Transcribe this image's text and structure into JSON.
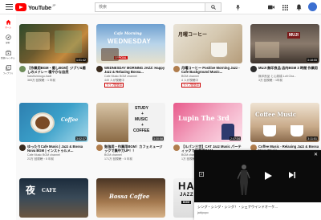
{
  "header": {
    "logo_text": "YouTube",
    "logo_region": "JP",
    "search_placeholder": "検索"
  },
  "sidebar": {
    "items": [
      {
        "label": "ホーム",
        "icon": "home-icon"
      },
      {
        "label": "探索",
        "icon": "explore-icon"
      },
      {
        "label": "登録チャンネル",
        "icon": "subscriptions-icon"
      },
      {
        "label": "ライブラリ",
        "icon": "library-icon"
      }
    ]
  },
  "videos": [
    {
      "title": "【作業用BGM・癒しBGM】ジブリ&癒しのメドレー 穏やかな自然",
      "channel": "harufiu/shogu-hadt",
      "stats": "369万 回視聴・1 年前",
      "duration": "1:01:42",
      "live": ""
    },
    {
      "title": "WEDNESDAY MORNING JAZZ: Happy Jazz & Relaxing Bossa...",
      "channel": "Cafe Music BGM channel",
      "stats": "449 人が視聴中",
      "duration": "",
      "live": "ライブ配信中"
    },
    {
      "title": "月曜コーヒー Positive Morning Jazz - Cafe Background Music...",
      "channel": "BGM channel",
      "stats": "4 人が視聴中",
      "duration": "",
      "live": "ライブ配信中"
    },
    {
      "title": "MUJI 無印良品 店内BGM 3 時間 作業用",
      "channel": "無印良品 と心斎橋 Lofi Cha...",
      "stats": "3万 回視聴・1年前",
      "duration": "3:18:55",
      "live": ""
    },
    {
      "title": "ゆったりCafe Music | Jazz & Bossa Nova BGM | インストゥルメ...",
      "channel": "Cafe Music BGM channel",
      "stats": "23万 回視聴・5 年前",
      "duration": "3:02:37",
      "live": ""
    },
    {
      "title": "勉強用・作業用BGM！カフェミュージックで集中力UP！！",
      "channel": "BGM channel",
      "stats": "171万 回視聴・5 年前",
      "duration": "3:30:58",
      "live": ""
    },
    {
      "title": "【ルパン三世】CAT Jazz Music パーティックで作業用BGM",
      "channel": "BGM channel",
      "stats": "1万 回視聴・5 年前",
      "duration": "2:07:34",
      "live": ""
    },
    {
      "title": "Coffee Music - Relaxing Jazz & Bossa Nova Music...",
      "channel": "BGM channel",
      "stats": "6万 回視聴・3 年前",
      "duration": "3:11:51",
      "live": ""
    },
    {
      "title": "夜 CAFE",
      "channel": "",
      "stats": "",
      "duration": "",
      "live": ""
    },
    {
      "title": "Bossa Coffee",
      "channel": "",
      "stats": "",
      "duration": "",
      "live": ""
    },
    {
      "title": "HAPPY JAZZ BOSSA",
      "channel": "",
      "stats": "",
      "duration": "",
      "live": ""
    }
  ],
  "thumb_text": {
    "t1": "",
    "t2a": "Cafe Morning",
    "t2b": "WEDNESDAY",
    "t2c": "OFFICIAL",
    "t3": "月曜コーヒー",
    "t4": "MUJI",
    "t5": "Coffee",
    "t6a": "STUDY",
    "t6b": "+",
    "t6c": "MUSIC",
    "t6d": "+",
    "t6e": "COFFEE",
    "t7": "Lupin The 3rd",
    "t8": "Coffee Music",
    "t9a": "夜",
    "t9b": "CAFE",
    "t10": "Bossa Coffee",
    "t11a": "HAPP",
    "t11b": "JAZZ BOSS",
    "t11c": "BGM"
  },
  "mini_player": {
    "title": "シング・シング・シング！・シェナウインドオーケ...",
    "channel": "jablpopo"
  },
  "colors": {
    "brand_red": "#ff0000",
    "live_red": "#cc0000"
  }
}
